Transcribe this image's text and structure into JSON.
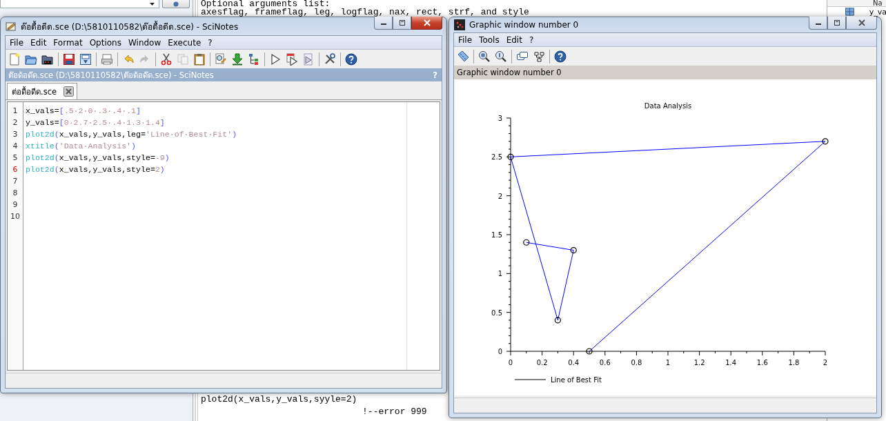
{
  "variable_browser": {
    "header": "Na",
    "rows": [
      "y_va"
    ]
  },
  "console": {
    "top_lines": [
      "Optional arguments list:",
      "axesflag, frameflag, leg, logflag, nax, rect, strf, and style"
    ],
    "bottom_lines": [
      "plot2d(x_vals,y_vals,syyle=2)",
      "                              !--error 999"
    ]
  },
  "scinotes": {
    "title": "ต๊อดื้อดีด.sce (D:\\5810110582\\ต๊อดื้อดีด.sce) - SciNotes",
    "active": true,
    "menu": [
      "File",
      "Edit",
      "Format",
      "Options",
      "Window",
      "Execute",
      "?"
    ],
    "toolbar": [
      {
        "kind": "new",
        "disabled": false
      },
      {
        "kind": "open",
        "disabled": false
      },
      {
        "kind": "open-dir",
        "disabled": false
      },
      {
        "kind": "sep"
      },
      {
        "kind": "save",
        "disabled": false
      },
      {
        "kind": "save-as",
        "disabled": false
      },
      {
        "kind": "sep"
      },
      {
        "kind": "print",
        "disabled": false
      },
      {
        "kind": "sep"
      },
      {
        "kind": "undo",
        "disabled": false
      },
      {
        "kind": "redo",
        "disabled": true
      },
      {
        "kind": "sep"
      },
      {
        "kind": "cut",
        "disabled": false
      },
      {
        "kind": "copy",
        "disabled": true
      },
      {
        "kind": "paste",
        "disabled": false
      },
      {
        "kind": "sep"
      },
      {
        "kind": "find",
        "disabled": false
      },
      {
        "kind": "load",
        "disabled": false
      },
      {
        "kind": "tree",
        "disabled": false
      },
      {
        "kind": "sep"
      },
      {
        "kind": "run",
        "disabled": false
      },
      {
        "kind": "run-file",
        "disabled": false
      },
      {
        "kind": "run-alt",
        "disabled": false
      },
      {
        "kind": "sep"
      },
      {
        "kind": "tools",
        "disabled": false
      },
      {
        "kind": "sep"
      },
      {
        "kind": "help",
        "disabled": false
      }
    ],
    "doc_header": {
      "text": "ต๊อด้อด๊ด.sce (D:\\5810110582\\ต๊อด้อด๊ด.sce) - SciNotes",
      "help": "?"
    },
    "tabs": [
      {
        "label": "ต่อดื้อดีด.sce",
        "selected": true
      }
    ],
    "lines": [
      {
        "number": "1",
        "current": false,
        "tokens": [
          {
            "kind": "var",
            "text": "x_vals"
          },
          {
            "kind": "op",
            "text": "="
          },
          {
            "kind": "bracket",
            "text": "["
          },
          {
            "kind": "num",
            "text": ".5·2·0·.3·.4·.1"
          },
          {
            "kind": "bracket",
            "text": "]"
          }
        ]
      },
      {
        "number": "2",
        "current": false,
        "tokens": [
          {
            "kind": "var",
            "text": "y_vals"
          },
          {
            "kind": "op",
            "text": "="
          },
          {
            "kind": "bracket",
            "text": "["
          },
          {
            "kind": "num",
            "text": "0·2.7·2.5·.4·1.3·1.4"
          },
          {
            "kind": "bracket",
            "text": "]"
          }
        ]
      },
      {
        "number": "3",
        "current": false,
        "tokens": [
          {
            "kind": "func",
            "text": "plot2d"
          },
          {
            "kind": "bracket",
            "text": "("
          },
          {
            "kind": "var",
            "text": "x_vals,y_vals,leg="
          },
          {
            "kind": "str",
            "text": "'Line·of·Best·Fit'"
          },
          {
            "kind": "bracket",
            "text": ")"
          }
        ]
      },
      {
        "number": "4",
        "current": false,
        "tokens": [
          {
            "kind": "func",
            "text": "xtitle"
          },
          {
            "kind": "bracket",
            "text": "("
          },
          {
            "kind": "str",
            "text": "'Data·Analysis'"
          },
          {
            "kind": "bracket",
            "text": ")"
          }
        ]
      },
      {
        "number": "5",
        "current": false,
        "tokens": [
          {
            "kind": "func",
            "text": "plot2d"
          },
          {
            "kind": "bracket",
            "text": "("
          },
          {
            "kind": "var",
            "text": "x_vals,y_vals,style="
          },
          {
            "kind": "num",
            "text": "-9"
          },
          {
            "kind": "bracket",
            "text": ")"
          }
        ]
      },
      {
        "number": "6",
        "current": true,
        "tokens": [
          {
            "kind": "func",
            "text": "plot2d"
          },
          {
            "kind": "bracket",
            "text": "("
          },
          {
            "kind": "var",
            "text": "x_vals,y_vals,style="
          },
          {
            "kind": "num",
            "text": "2"
          },
          {
            "kind": "bracket",
            "text": ")"
          }
        ]
      },
      {
        "number": "7",
        "current": false
      },
      {
        "number": "8",
        "current": false
      },
      {
        "number": "9",
        "current": false
      },
      {
        "number": "10",
        "current": false
      }
    ]
  },
  "graphic": {
    "title": "Graphic window number 0",
    "active": false,
    "menu": [
      "File",
      "Tools",
      "Edit",
      "?"
    ],
    "toolbar": [
      {
        "kind": "rotate",
        "disabled": false
      },
      {
        "kind": "sep"
      },
      {
        "kind": "zoom",
        "disabled": false
      },
      {
        "kind": "zoom-reset",
        "disabled": false
      },
      {
        "kind": "sep"
      },
      {
        "kind": "datatips",
        "disabled": false
      },
      {
        "kind": "editor",
        "disabled": false
      },
      {
        "kind": "sep"
      },
      {
        "kind": "help",
        "disabled": false
      }
    ],
    "info": "Graphic window number 0",
    "chart_data": {
      "type": "line",
      "title": "Data Analysis",
      "x": [
        0.5,
        2,
        0,
        0.3,
        0.4,
        0.1
      ],
      "series": [
        {
          "name": "Line of Best Fit",
          "color": "#0000ff",
          "marker": "circle",
          "values": [
            0,
            2.7,
            2.5,
            0.4,
            1.3,
            1.4
          ]
        }
      ],
      "xlim": [
        0,
        2
      ],
      "ylim": [
        0,
        3
      ],
      "xticks": [
        0,
        0.2,
        0.4,
        0.6,
        0.8,
        1,
        1.2,
        1.4,
        1.6,
        1.8,
        2
      ],
      "yticks": [
        0,
        0.5,
        1,
        1.5,
        2,
        2.5,
        3
      ]
    }
  }
}
